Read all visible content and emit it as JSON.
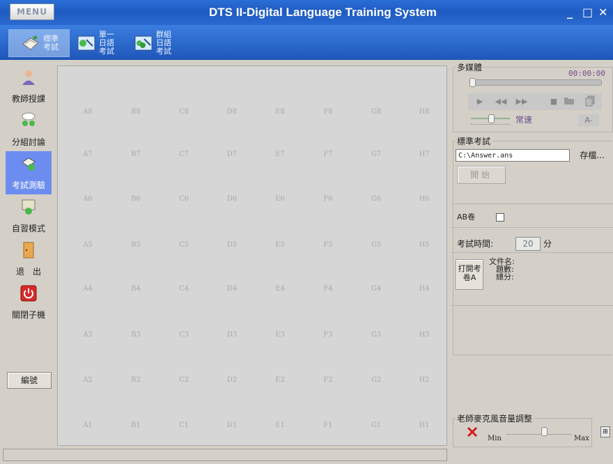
{
  "window": {
    "menu_label": "MENU",
    "title": "DTS II-Digital Language Training System",
    "minimize": "_",
    "maximize": "□",
    "close": "✕"
  },
  "toolbar": {
    "items": [
      {
        "label": "標準考試",
        "icon": "standard-exam-icon",
        "active": true
      },
      {
        "label": "單一日語考試",
        "icon": "single-japanese-exam-icon"
      },
      {
        "label": "群組日語考試",
        "icon": "group-japanese-exam-icon"
      }
    ]
  },
  "sidebar": {
    "items": [
      {
        "label": "教師授課",
        "icon": "teacher-icon"
      },
      {
        "label": "分組討論",
        "icon": "group-discussion-icon"
      },
      {
        "label": "考試測驗",
        "icon": "exam-icon",
        "active": true
      },
      {
        "label": "自習模式",
        "icon": "self-study-icon"
      },
      {
        "label": "退　出",
        "icon": "exit-door-icon"
      },
      {
        "label": "關閉子機",
        "icon": "power-icon"
      }
    ],
    "number_button": "編號"
  },
  "seat_grid": {
    "columns": [
      "A",
      "B",
      "C",
      "D",
      "E",
      "F",
      "G",
      "H"
    ],
    "rows": [
      [
        "A8",
        "B8",
        "C8",
        "D8",
        "E8",
        "F8",
        "G8",
        "H8"
      ],
      [
        "A7",
        "B7",
        "C7",
        "D7",
        "E7",
        "F7",
        "G7",
        "H7"
      ],
      [
        "A6",
        "B6",
        "C6",
        "D6",
        "E6",
        "F6",
        "G6",
        "H6"
      ],
      [
        "A5",
        "B5",
        "C5",
        "D5",
        "E5",
        "F5",
        "G5",
        "H5"
      ],
      [
        "A4",
        "B4",
        "C4",
        "D4",
        "E4",
        "F4",
        "G4",
        "H4"
      ],
      [
        "A3",
        "B3",
        "C3",
        "D3",
        "E3",
        "F3",
        "G3",
        "H3"
      ],
      [
        "A2",
        "B2",
        "C2",
        "D2",
        "E2",
        "F2",
        "G2",
        "H2"
      ],
      [
        "A1",
        "B1",
        "C1",
        "D1",
        "E1",
        "F1",
        "G1",
        "H1"
      ]
    ]
  },
  "multimedia": {
    "legend": "多媒體",
    "time": "00:00:00",
    "speed_label": "常速",
    "a_minus": "A-",
    "progress": 0
  },
  "standard_exam": {
    "legend": "標準考試",
    "file_path": "C:\\Answer.ans",
    "save_button": "存檔...",
    "start_button": "開始",
    "ab_label": "AB卷",
    "ab_checked": false,
    "time_label": "考試時間:",
    "time_value": "20",
    "time_unit": "分",
    "open_button": "打開考卷A",
    "file_name_label": "文件名:",
    "question_count_label": "題數:",
    "total_score_label": "總分:"
  },
  "mic": {
    "legend": "老師麥克風音量調整",
    "min_label": "Min",
    "max_label": "Max",
    "level": 0.58
  }
}
